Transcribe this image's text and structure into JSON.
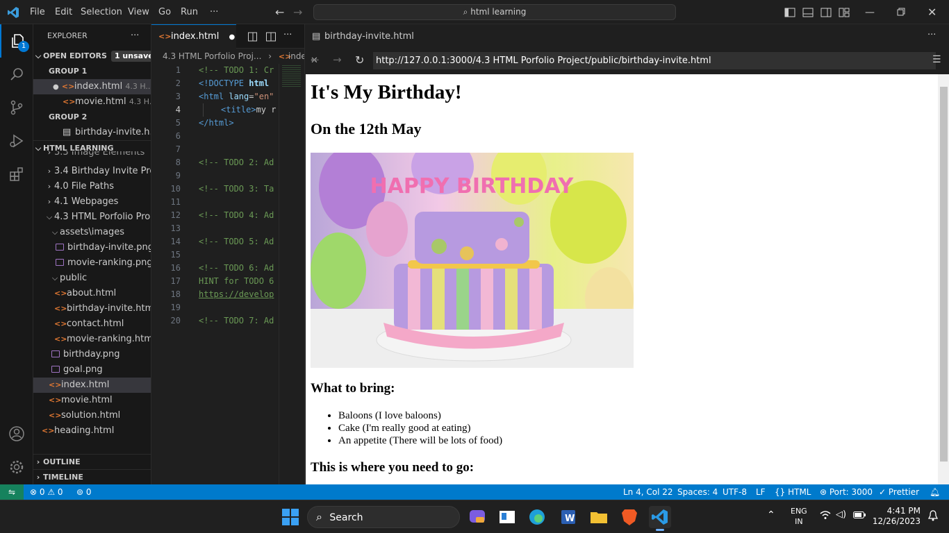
{
  "titlebar": {
    "menus": [
      "File",
      "Edit",
      "Selection",
      "View",
      "Go",
      "Run",
      "···"
    ],
    "search": "html learning"
  },
  "activity": {
    "explorer_badge": "1"
  },
  "sidebar": {
    "title": "EXPLORER",
    "more": "···",
    "open_editors": {
      "label": "OPEN EDITORS",
      "badge": "1 unsaved"
    },
    "groups": [
      {
        "label": "GROUP 1",
        "files": [
          {
            "name": "index.html",
            "desc": "4.3 H..."
          },
          {
            "name": "movie.html",
            "desc": "4.3 H..."
          }
        ]
      },
      {
        "label": "GROUP 2",
        "files": [
          {
            "name": "birthday-invite.h...",
            "desc": ""
          }
        ]
      }
    ],
    "folder": "HTML LEARNING",
    "tree": [
      "3.3 Image Elements",
      "3.4 Birthday Invite Pro...",
      "4.0 File Paths",
      "4.1 Webpages",
      "4.3 HTML Porfolio Pro...",
      "assets\\images",
      "birthday-invite.png",
      "movie-ranking.png",
      "public",
      "about.html",
      "birthday-invite.html",
      "contact.html",
      "movie-ranking.html",
      "birthday.png",
      "goal.png",
      "index.html",
      "movie.html",
      "solution.html",
      "heading.html"
    ],
    "outline": "OUTLINE",
    "timeline": "TIMELINE"
  },
  "editor": {
    "tab": "index.html",
    "breadcrumb": "4.3 HTML Porfolio Proj...",
    "breadcrumb_file": "inde",
    "lines": [
      "1",
      "2",
      "3",
      "4",
      "5",
      "6",
      "7",
      "8",
      "9",
      "10",
      "11",
      "12",
      "13",
      "14",
      "15",
      "16",
      "17",
      "18",
      "19",
      "20"
    ],
    "code": {
      "l1": "<!-- TODO 1: Cr",
      "l2a": "<!DOCTYPE ",
      "l2b": "html",
      "l3a": "<html ",
      "l3b": "lang",
      "l3c": "=",
      "l3d": "\"en\"",
      "l4a": "<title>",
      "l4b": "my r",
      "l5": "</html>",
      "l8": "<!-- TODO 2: Ad",
      "l10": "<!-- TODO 3: Ta",
      "l12": "<!-- TODO 4: Ad",
      "l14": "<!-- TODO 5: Ad",
      "l16": "<!-- TODO 6: Ad",
      "l17": "HINT for TODO 6",
      "l18": "https://develop",
      "l20": "<!-- TODO 7: Ad"
    }
  },
  "browser": {
    "tab": "birthday-invite.html",
    "url": "http://127.0.0.1:3000/4.3 HTML Porfolio Project/public/birthday-invite.html",
    "page": {
      "h1": "It's My Birthday!",
      "h2": "On the 12th May",
      "bring": "What to bring:",
      "items": [
        "Baloons (I love baloons)",
        "Cake (I'm really good at eating)",
        "An appetite (There will be lots of food)"
      ],
      "where": "This is where you need to go:",
      "cake_text": "HAPPY BIRTHDAY"
    }
  },
  "statusbar": {
    "errors": "0",
    "warnings": "0",
    "ports": "0",
    "position": "Ln 4, Col 22",
    "spaces": "Spaces: 4",
    "encoding": "UTF-8",
    "eol": "LF",
    "language": "HTML",
    "port": "Port: 3000",
    "prettier": "Prettier"
  },
  "taskbar": {
    "search": "Search",
    "lang1": "ENG",
    "lang2": "IN",
    "time": "4:41 PM",
    "date": "12/26/2023"
  },
  "colors": {
    "accent": "#0078d4",
    "statusbar": "#007acc",
    "html_icon": "#e37933"
  }
}
